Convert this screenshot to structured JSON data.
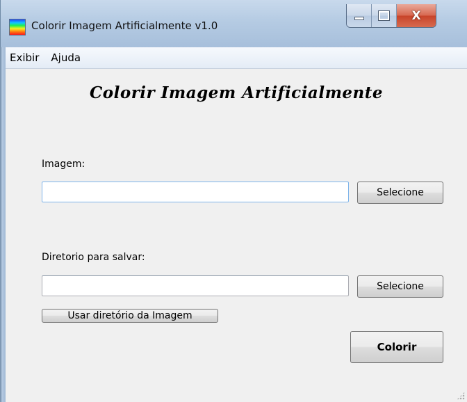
{
  "window": {
    "title": "Colorir Imagem Artificialmente v1.0",
    "app_icon": "rainbow-gradient-icon",
    "controls": {
      "minimize": "minimize-icon",
      "maximize": "maximize-icon",
      "close_label": "X"
    }
  },
  "menu": {
    "items": [
      {
        "label": "Exibir"
      },
      {
        "label": "Ajuda"
      }
    ]
  },
  "main": {
    "heading": "Colorir Imagem Artificialmente",
    "image": {
      "label": "Imagem:",
      "value": "",
      "placeholder": "",
      "select_label": "Selecione"
    },
    "save_dir": {
      "label": "Diretorio para salvar:",
      "value": "",
      "placeholder": "",
      "select_label": "Selecione"
    },
    "use_image_dir_label": "Usar diretório da Imagem",
    "colorize_label": "Colorir"
  },
  "colors": {
    "title_bar": "#b5cbe3",
    "client_bg": "#f0f0f0",
    "close_button": "#c8442a"
  }
}
